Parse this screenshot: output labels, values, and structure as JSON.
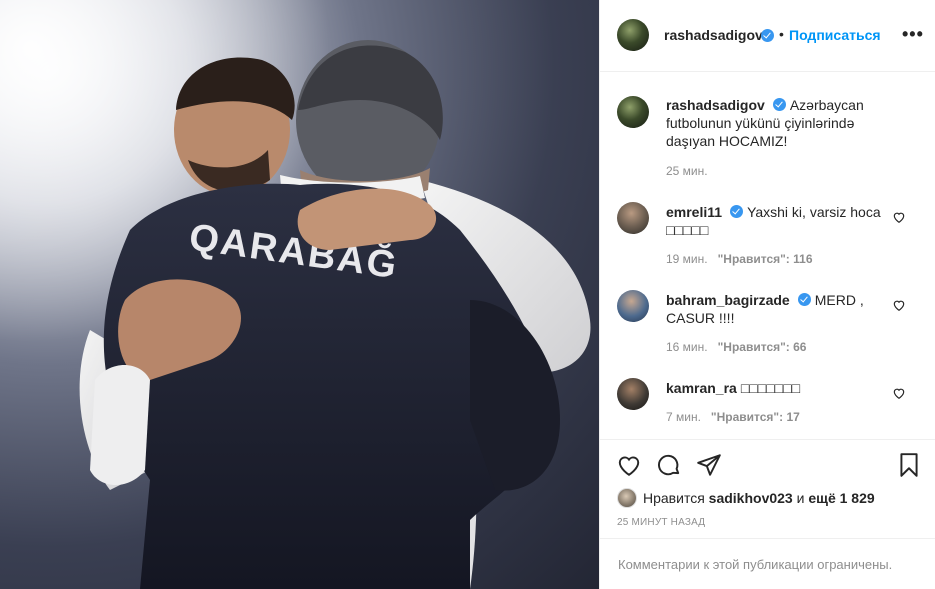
{
  "post": {
    "author": "rashadsadigov",
    "follow_label": "Подписаться",
    "more_label": "•••",
    "dot": "•"
  },
  "caption": {
    "author": "rashadsadigov",
    "text": "Azərbaycan futbolunun yükünü çiyinlərində daşıyan HOCAMIZ!",
    "time": "25 мин."
  },
  "comments": [
    {
      "author": "emreli11",
      "verified": true,
      "text": "Yaxshi ki, varsiz hoca □□□□□",
      "time": "19 мин.",
      "likes_label": "\"Нравится\": 116"
    },
    {
      "author": "bahram_bagirzade",
      "verified": true,
      "text": "MERD , CASUR !!!!",
      "time": "16 мин.",
      "likes_label": "\"Нравится\": 66"
    },
    {
      "author": "kamran_ra",
      "verified": false,
      "text": "□□□□□□□",
      "time": "7 мин.",
      "likes_label": "\"Нравится\": 17"
    }
  ],
  "likes": {
    "prefix": "Нравится",
    "user": "sadikhov023",
    "middle": "и",
    "count": "ещё 1 829"
  },
  "timestamp": "25 МИНУТ НАЗАД",
  "comments_limited": "Комментарии к этой публикации ограничены.",
  "photo": {
    "jersey_text": "QARABAĞ"
  },
  "icons": [
    "heart-icon",
    "comment-icon",
    "share-icon",
    "bookmark-icon",
    "verified-icon",
    "more-icon"
  ],
  "colors": {
    "link": "#0095f6",
    "verified": "#3897f0",
    "muted": "#8e8e8e",
    "border": "#efefef"
  }
}
